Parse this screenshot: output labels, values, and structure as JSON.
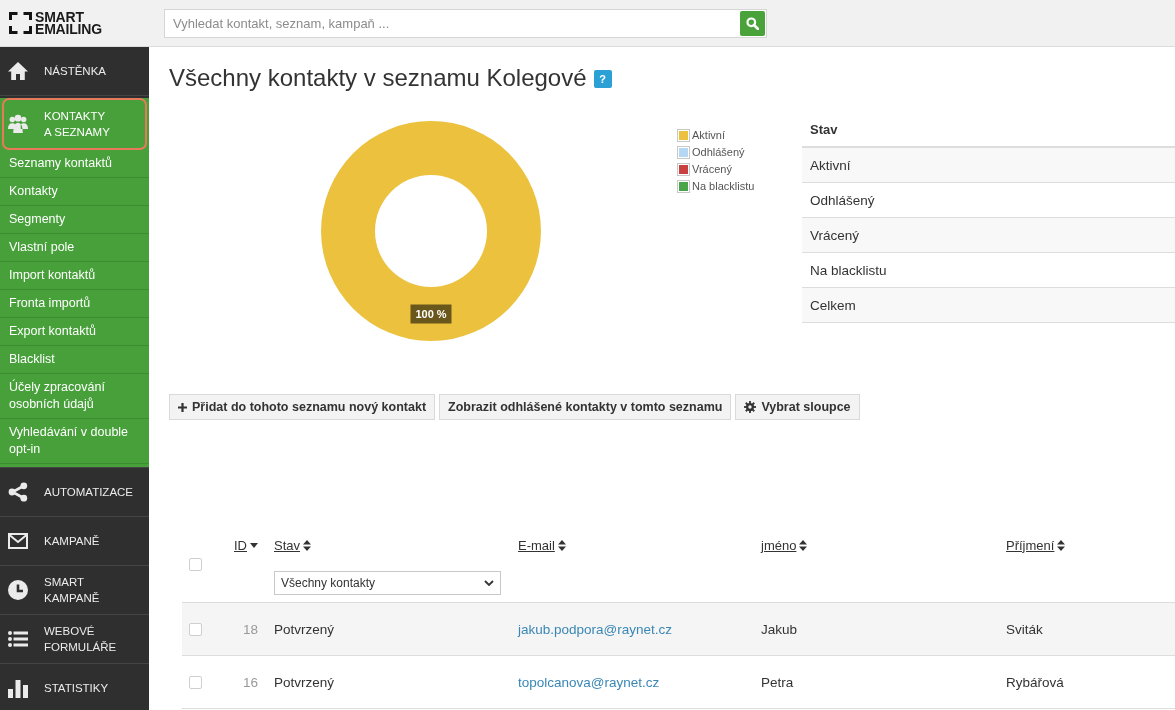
{
  "header": {
    "logo": "SMART\nEMAILING",
    "search": {
      "placeholder": "Vyhledat kontakt, seznam, kampaň ..."
    }
  },
  "sidebar": {
    "items": [
      {
        "label": "NÁSTĚNKA",
        "selected": false,
        "expanded": false
      },
      {
        "label": "KONTAKTY\nA SEZNAMY",
        "selected": true,
        "expanded": true,
        "children": [
          {
            "label": "Seznamy kontaktů"
          },
          {
            "label": "Kontakty"
          },
          {
            "label": "Segmenty"
          },
          {
            "label": "Vlastní pole"
          },
          {
            "label": "Import kontaktů"
          },
          {
            "label": "Fronta importů"
          },
          {
            "label": "Export kontaktů"
          },
          {
            "label": "Blacklist"
          },
          {
            "label": "Účely zpracování osobních údajů"
          },
          {
            "label": "Vyhledávání v double opt-in"
          }
        ]
      },
      {
        "label": "AUTOMATIZACE",
        "selected": false,
        "expanded": false
      },
      {
        "label": "KAMPANĚ",
        "selected": false,
        "expanded": false
      },
      {
        "label": "SMART\nKAMPANĚ",
        "selected": false,
        "expanded": false
      },
      {
        "label": "WEBOVÉ\nFORMULÁŘE",
        "selected": false,
        "expanded": false
      },
      {
        "label": "STATISTIKY",
        "selected": false,
        "expanded": false
      }
    ]
  },
  "page": {
    "title": "Všechny kontakty v seznamu Kolegové",
    "help_badge": "?"
  },
  "chart": {
    "chart_data": {
      "type": "donut",
      "categories": [
        "Aktivní",
        "Odhlášený",
        "Vrácený",
        "Na blacklistu"
      ],
      "values": [
        100,
        0,
        0,
        0
      ],
      "value_labels": [
        "100 %",
        null,
        null,
        null
      ]
    },
    "legend": [
      {
        "color": "#ebc13e"
      },
      {
        "color": "#b5d7f3"
      },
      {
        "color": "#c94040"
      },
      {
        "color": "#4aa44a"
      }
    ]
  },
  "status_table": {
    "columns": [
      "Stav"
    ],
    "rows": [
      "Aktivní",
      "Odhlášený",
      "Vrácený",
      "Na blacklistu",
      "Celkem"
    ]
  },
  "toolbar": {
    "buttons": [
      {
        "label": "Přidat do tohoto seznamu nový kontakt",
        "kind": "add"
      },
      {
        "label": "Zobrazit odhlášené kontakty v tomto seznamu",
        "kind": "plain"
      },
      {
        "label": "Vybrat sloupce",
        "kind": "settings"
      }
    ]
  },
  "contacts_table": {
    "select_all_checked": false,
    "columns": [
      {
        "label": "ID",
        "sorted": true,
        "kind": "number"
      },
      {
        "label": "Stav",
        "sorted": false,
        "kind": "text",
        "filter": "Všechny kontakty"
      },
      {
        "label": "E-mail",
        "sorted": false,
        "kind": "link"
      },
      {
        "label": "jméno",
        "sorted": false,
        "kind": "text"
      },
      {
        "label": "Příjmení",
        "sorted": false,
        "kind": "text"
      }
    ],
    "rows": [
      {
        "checked": false,
        "cells": [
          "18",
          "Potvrzený",
          "jakub.podpora@raynet.cz",
          "Jakub",
          "Sviták"
        ]
      },
      {
        "checked": false,
        "cells": [
          "16",
          "Potvrzený",
          "topolcanova@raynet.cz",
          "Petra",
          "Rybářová"
        ]
      }
    ]
  }
}
